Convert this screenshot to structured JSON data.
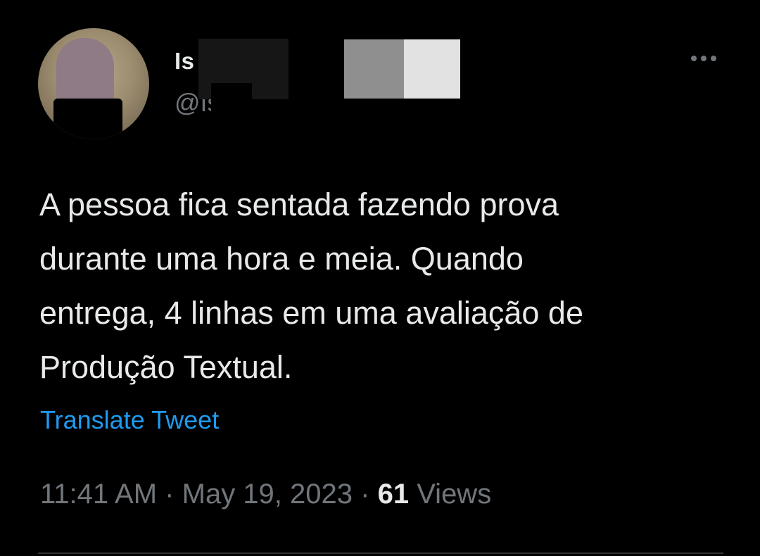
{
  "tweet": {
    "author": {
      "display_name": "Is",
      "handle": "@Is",
      "avatar_icon": "profile-avatar"
    },
    "more_icon": "more-horizontal-icon",
    "text": "A pessoa fica sentada fazendo prova\ndurante uma hora e meia. Quando\nentrega, 4 linhas em uma avaliação de\nProdução Textual.",
    "translate_label": "Translate Tweet",
    "timestamp": "11:41 AM",
    "date": "May 19, 2023",
    "separator": "·",
    "views_count": "61",
    "views_label": "Views"
  },
  "colors": {
    "background": "#000000",
    "primary_text": "#e7e9ea",
    "secondary_text": "#71767b",
    "link": "#1d9bf0"
  }
}
